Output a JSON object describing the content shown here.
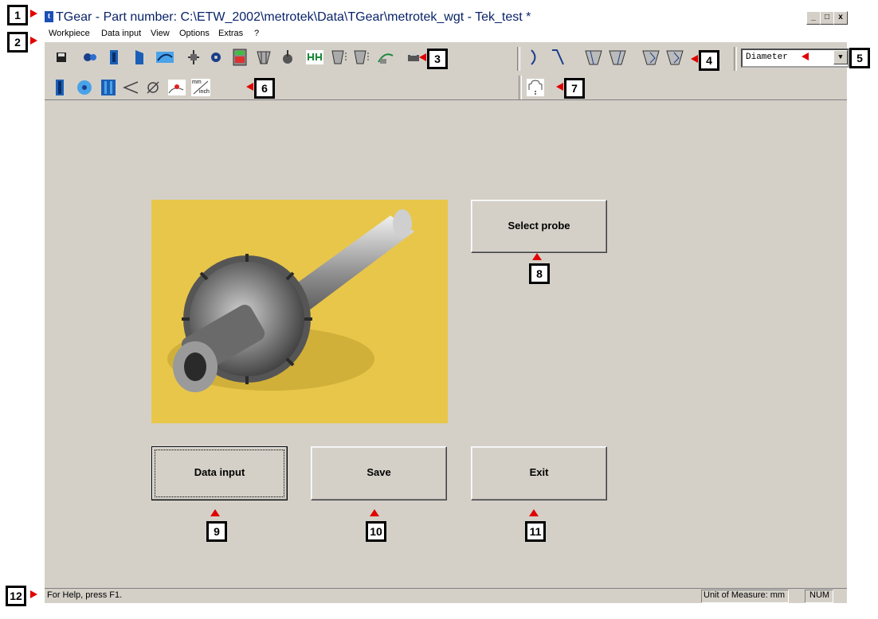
{
  "window": {
    "title": "TGear - Part number: C:\\ETW_2002\\metrotek\\Data\\TGear\\metrotek_wgt - Tek_test *",
    "app_icon_letter": "t",
    "minimize": "_",
    "maximize": "□",
    "close": "x"
  },
  "menu": {
    "items": [
      "Workpiece",
      "Data input",
      "View",
      "Options",
      "Extras",
      "?"
    ]
  },
  "toolbar": {
    "unit_label_top": "mm",
    "unit_label_bottom": "inch",
    "dropdown_value": "Diameter",
    "dropdown_arrow": "▼"
  },
  "main": {
    "select_probe": "Select probe",
    "data_input": "Data input",
    "save": "Save",
    "exit": "Exit"
  },
  "status": {
    "help": "For Help, press F1.",
    "unit": "Unit of Measure: mm",
    "num": "NUM"
  },
  "callouts": [
    "1",
    "2",
    "3",
    "4",
    "5",
    "6",
    "7",
    "8",
    "9",
    "10",
    "11",
    "12"
  ],
  "colors": {
    "accent": "#0a246a",
    "callout_arrow": "#e00000",
    "photo_bg": "#e8c64a"
  }
}
